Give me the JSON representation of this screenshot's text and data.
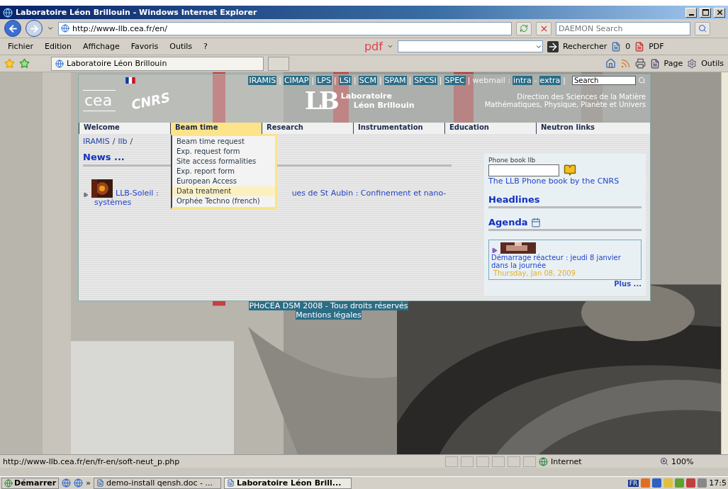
{
  "window": {
    "title": "Laboratoire Léon Brillouin - Windows Internet Explorer"
  },
  "address": {
    "url": "http://www-llb.cea.fr/en/"
  },
  "search": {
    "placeholder": "DAEMON Search"
  },
  "menu": [
    "Fichier",
    "Edition",
    "Affichage",
    "Favoris",
    "Outils",
    "?"
  ],
  "pdf_toolbar": {
    "logo": "pdf",
    "button": "Rechercher",
    "count": "0",
    "pdf": "PDF"
  },
  "tab": {
    "title": "Laboratoire Léon Brillouin"
  },
  "command_bar": [
    "Page",
    "Outils"
  ],
  "site": {
    "top_links": [
      "IRAMIS",
      "CIMAP",
      "LPS",
      "LSI",
      "SCM",
      "SPAM",
      "SPCSI",
      "SPEC"
    ],
    "separator": "|",
    "webmail_label": "webmail :",
    "webmail_links": [
      "intra",
      "extra"
    ],
    "webmail_separator": "-",
    "search_value": "Search",
    "logos": {
      "cea": "cea",
      "cnrs": "CNRS",
      "lb": "LB",
      "name_line1": "Laboratoire",
      "name_line2": "Léon Brillouin"
    },
    "direction": [
      "Direction des Sciences de la Matière",
      "Mathématiques, Physique, Planète et Univers"
    ]
  },
  "nav": [
    {
      "label": "Welcome",
      "selected": false
    },
    {
      "label": "Beam time",
      "selected": true
    },
    {
      "label": "Research",
      "selected": false
    },
    {
      "label": "Instrumentation",
      "selected": false
    },
    {
      "label": "Education",
      "selected": false
    },
    {
      "label": "Neutron links",
      "selected": false
    }
  ],
  "dropdown": [
    {
      "label": "Beam time request",
      "selected": false
    },
    {
      "label": "Exp. request form",
      "selected": false
    },
    {
      "label": "Site access formalities",
      "selected": false
    },
    {
      "label": "Exp. report form",
      "selected": false
    },
    {
      "label": "European Access",
      "selected": false
    },
    {
      "label": "Data treatment",
      "selected": true
    },
    {
      "label": "Orphée Techno (french)",
      "selected": false
    }
  ],
  "breadcrumb": {
    "items": [
      "IRAMIS",
      "llb"
    ],
    "separator": "/"
  },
  "news": {
    "title": "News ...",
    "items": [
      {
        "before": "LLB-Soleil :",
        "after": "ues de St Aubin : Confinement et nano-",
        "line2": "systèmes"
      }
    ]
  },
  "sidebar": {
    "phone_label": "Phone book llb",
    "phone_link": "The LLB Phone book by the CNRS",
    "headlines": "Headlines",
    "agenda": "Agenda",
    "event": {
      "title": "Démarrage réacteur : jeudi 8 janvier dans la journée",
      "date": "Thursday, Jan 08, 2009"
    },
    "more": "Plus ..."
  },
  "footer": [
    "PHoCEA DSM 2008 - Tous droits réservés",
    "Mentions légales"
  ],
  "status": {
    "url": "http://www-llb.cea.fr/en/fr-en/soft-neut_p.php",
    "zone": "Internet",
    "zoom": "100%"
  },
  "taskbar": {
    "start": "Démarrer",
    "chevron": "»",
    "tasks": [
      {
        "label": "demo-install qensh.doc - ...",
        "selected": false
      },
      {
        "label": "Laboratoire Léon Brill...",
        "selected": true
      }
    ],
    "lang": "FR",
    "clock": "17:5"
  }
}
